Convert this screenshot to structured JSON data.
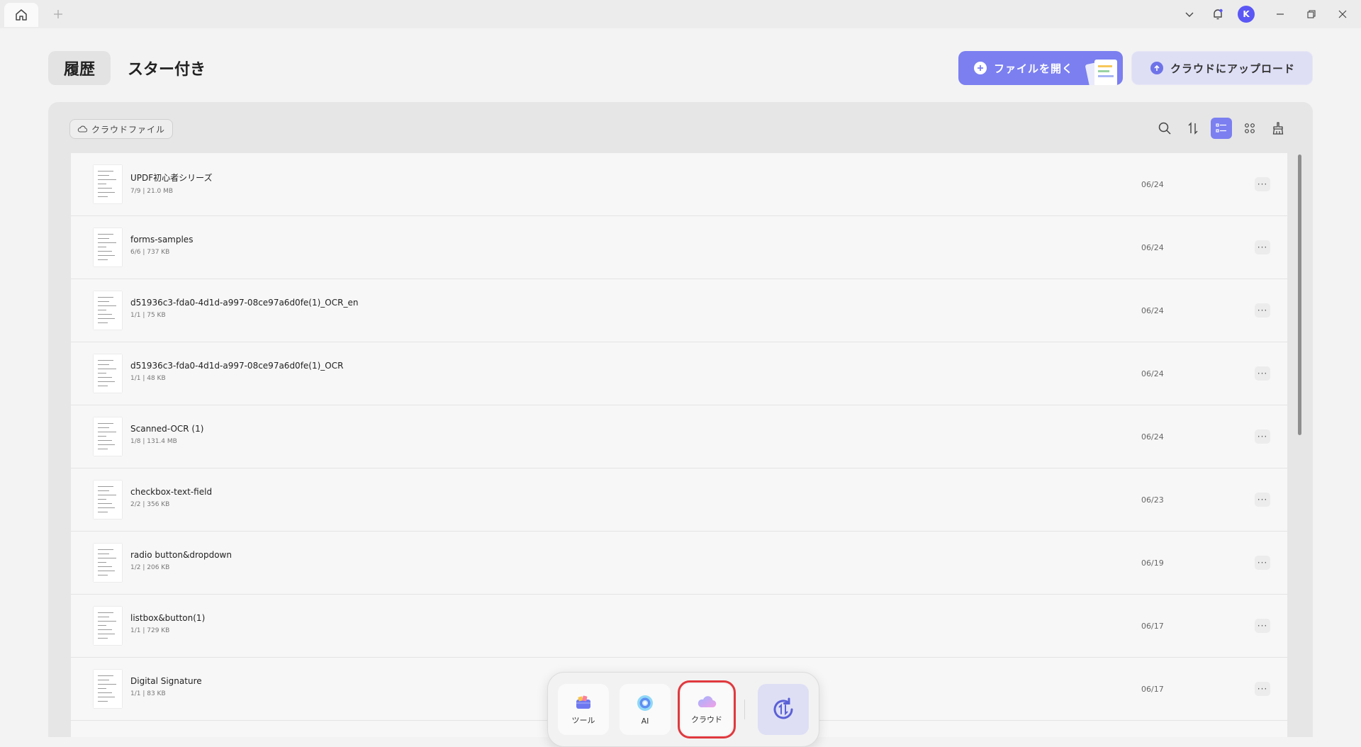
{
  "titlebar": {
    "avatar_letter": "K"
  },
  "tabs": {
    "history": "履歴",
    "starred": "スター付き"
  },
  "actions": {
    "open_file": "ファイルを開く",
    "upload_cloud": "クラウドにアップロード"
  },
  "panel": {
    "cloud_chip": "クラウドファイル"
  },
  "files": [
    {
      "name": "UPDF初心者シリーズ",
      "meta": "7/9 | 21.0 MB",
      "date": "06/24"
    },
    {
      "name": "forms-samples",
      "meta": "6/6 | 737 KB",
      "date": "06/24"
    },
    {
      "name": "d51936c3-fda0-4d1d-a997-08ce97a6d0fe(1)_OCR_en",
      "meta": "1/1 | 75 KB",
      "date": "06/24"
    },
    {
      "name": "d51936c3-fda0-4d1d-a997-08ce97a6d0fe(1)_OCR",
      "meta": "1/1 | 48 KB",
      "date": "06/24"
    },
    {
      "name": "Scanned-OCR (1)",
      "meta": "1/8 | 131.4 MB",
      "date": "06/24"
    },
    {
      "name": "checkbox-text-field",
      "meta": "2/2 | 356 KB",
      "date": "06/23"
    },
    {
      "name": "radio button&dropdown",
      "meta": "1/2 | 206 KB",
      "date": "06/19"
    },
    {
      "name": "listbox&button(1)",
      "meta": "1/1 | 729 KB",
      "date": "06/17"
    },
    {
      "name": "Digital Signature",
      "meta": "1/1 | 83 KB",
      "date": "06/17"
    }
  ],
  "more_label": "···",
  "dock": {
    "tools": "ツール",
    "ai": "AI",
    "cloud": "クラウド"
  },
  "colors": {
    "accent": "#7b7ff0",
    "highlight": "#e0393e"
  }
}
